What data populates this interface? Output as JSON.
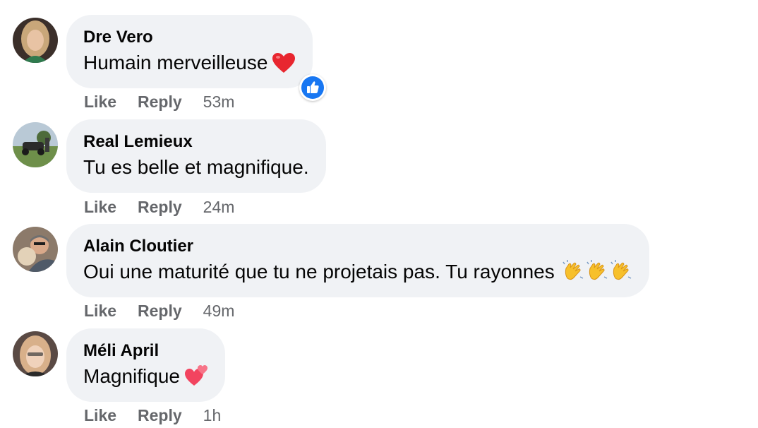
{
  "colors": {
    "bubble_bg": "#f0f2f5",
    "author_text": "#050505",
    "meta_text": "#65676b",
    "like_blue": "#1877f2"
  },
  "comments": [
    {
      "author": "Dre Vero",
      "text": "Humain merveilleuse",
      "emoji": [
        "heart-emoji"
      ],
      "reaction": "like-reaction-icon",
      "like_label": "Like",
      "reply_label": "Reply",
      "time": "53m"
    },
    {
      "author": "Real Lemieux",
      "text": "Tu es belle et magnifique.",
      "emoji": [],
      "like_label": "Like",
      "reply_label": "Reply",
      "time": "24m"
    },
    {
      "author": "Alain Cloutier",
      "text": "Oui une maturité que tu ne projetais pas. Tu rayonnes",
      "emoji": [
        "clapping-hands-emoji",
        "clapping-hands-emoji",
        "clapping-hands-emoji"
      ],
      "like_label": "Like",
      "reply_label": "Reply",
      "time": "49m"
    },
    {
      "author": "Méli April",
      "text": "Magnifique",
      "emoji": [
        "two-hearts-emoji"
      ],
      "like_label": "Like",
      "reply_label": "Reply",
      "time": "1h"
    }
  ]
}
